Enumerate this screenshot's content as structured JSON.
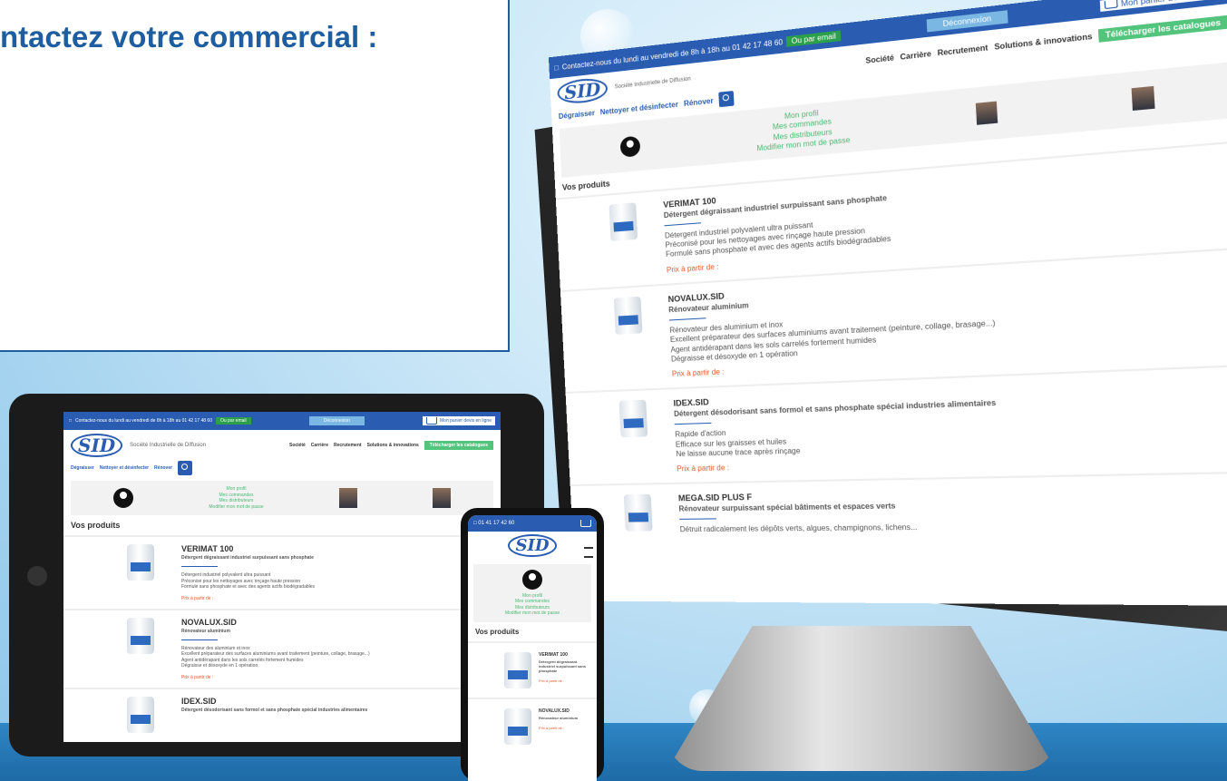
{
  "callout": {
    "title": "ntactez votre commercial :"
  },
  "site": {
    "topbar": {
      "contact": "Contactez-nous du lundi au vendredi de 8h à 18h au 01 42 17 48 60",
      "mail_button": "Ou par email",
      "deconnexion": "Déconnexion",
      "shop": "Mon panier\ndevis en ligne"
    },
    "logo": "SID",
    "tagline": "Société Industrielle de Diffusion",
    "nav": [
      "Société",
      "Carrière",
      "Recrutement",
      "Solutions & innovations"
    ],
    "catalog_button": "Télécharger les catalogues",
    "subnav": [
      "Dégraisser",
      "Nettoyer et désinfecter",
      "Rénover"
    ],
    "profile_links": [
      "Mon profil",
      "Mes commandes",
      "Mes distributeurs",
      "Modifier mon mot de passe"
    ],
    "products_title": "Vos produits",
    "price_prefix": "Prix à partir de :",
    "products": [
      {
        "name": "VERIMAT 100",
        "desc": "Détergent dégraissant industriel surpuissant sans phosphate",
        "bullets": [
          "Détergent industriel polyvalent ultra puissant",
          "Préconisé pour les nettoyages avec rinçage haute pression",
          "Formulé sans phosphate et avec des agents actifs biodégradables"
        ]
      },
      {
        "name": "NOVALUX.SID",
        "desc": "Rénovateur aluminium",
        "bullets": [
          "Rénovateur des aluminium et inox",
          "Excellent préparateur des surfaces aluminiums avant traitement (peinture, collage, brasage...)",
          "Agent antidérapant dans les sols carrelés fortement humides",
          "Dégraisse et désoxyde en 1 opération"
        ]
      },
      {
        "name": "IDEX.SID",
        "desc": "Détergent désodorisant sans formol et sans phosphate spécial industries alimentaires",
        "bullets": [
          "Rapide d'action",
          "Efficace sur les graisses et huiles",
          "Ne laisse aucune trace après rinçage"
        ]
      },
      {
        "name": "MEGA.SID PLUS F",
        "desc": "Rénovateur surpuissant spécial bâtiments et espaces verts",
        "bullets": [
          "Détruit radicalement les dépôts verts, algues, champignons, lichens..."
        ]
      }
    ]
  },
  "phone": {
    "contact": "01 41 17 42 60"
  }
}
